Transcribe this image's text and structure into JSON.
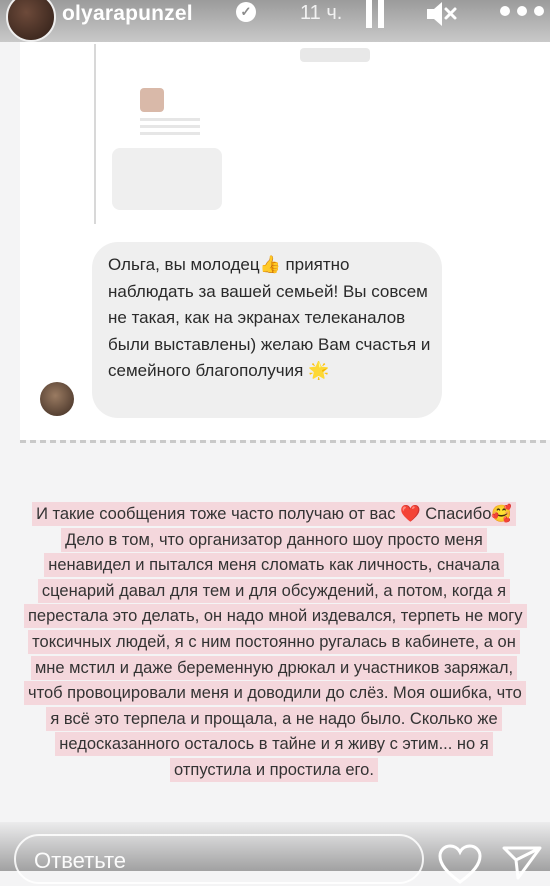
{
  "story": {
    "username": "olyarapunzel",
    "time": "11 ч."
  },
  "quoted_message": {
    "text": "Ольга, вы молодец👍 приятно наблюдать за вашей семьей! Вы совсем не такая, как на экранах телеканалов были выставлены) желаю Вам счастья и семейного благополучия 🌟"
  },
  "reply": {
    "text": "И такие сообщения тоже часто получаю от вас ❤️ Спасибо🥰 Дело в том, что организатор данного шоу просто меня ненавидел и пытался меня сломать как личность, сначала сценарий давал для тем и для обсуждений, а потом, когда я перестала это делать, он надо мной издевался, терпеть не могу токсичных людей, я с ним постоянно ругалась в кабинете, а он мне мстил и даже беременную дрюкал и участников заряжал, чтоб провоцировали меня и доводили до слёз. Моя ошибка, что я всё это терпела и прощала, а не надо было. Сколько же недосказанного осталось в тайне и я живу с этим... но я отпустила и простила его."
  },
  "footer": {
    "reply_placeholder": "Ответьте"
  },
  "icons": {
    "verified": "verified-badge-icon",
    "pause": "pause-icon",
    "mute": "speaker-muted-icon",
    "more": "more-dots-icon",
    "like": "heart-outline-icon",
    "send": "paper-plane-icon"
  },
  "colors": {
    "highlight": "#f4d7dc",
    "bubble": "#efefef"
  }
}
